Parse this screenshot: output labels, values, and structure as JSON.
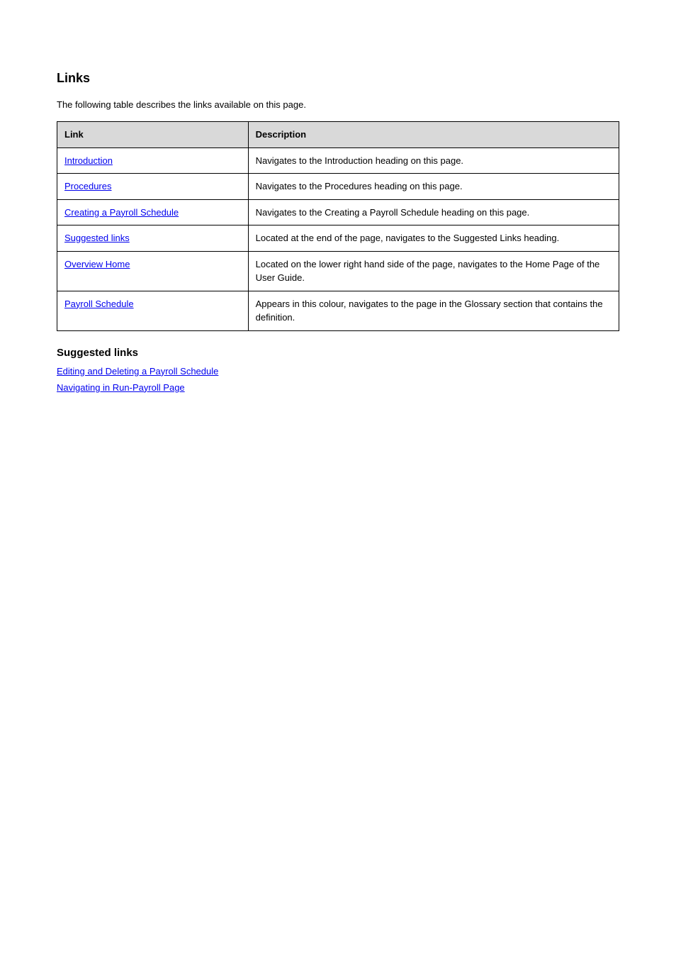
{
  "heading": "Links",
  "intro": "The following table describes the links available on this page.",
  "table": {
    "headers": {
      "link": "Link",
      "description": "Description"
    },
    "rows": [
      {
        "link": "Introduction",
        "description": "Navigates to the Introduction heading on this page."
      },
      {
        "link": "Procedures",
        "description": "Navigates to the Procedures heading on this page."
      },
      {
        "link": "Creating a Payroll Schedule",
        "description": "Navigates to the Creating a Payroll Schedule heading on this page."
      },
      {
        "link": "Suggested links",
        "description": "Located at the end of the page, navigates to the Suggested Links heading."
      },
      {
        "link": "Overview Home",
        "description": "Located on the lower right hand side of the page, navigates to the Home Page of the User Guide."
      },
      {
        "link": "Payroll Schedule",
        "description": "Appears in this colour, navigates to the page in the Glossary section that contains the definition."
      }
    ]
  },
  "suggested": {
    "heading": "Suggested links",
    "links": [
      {
        "label": "Editing and Deleting a Payroll Schedule"
      },
      {
        "label": "Navigating in Run-Payroll Page"
      }
    ]
  }
}
